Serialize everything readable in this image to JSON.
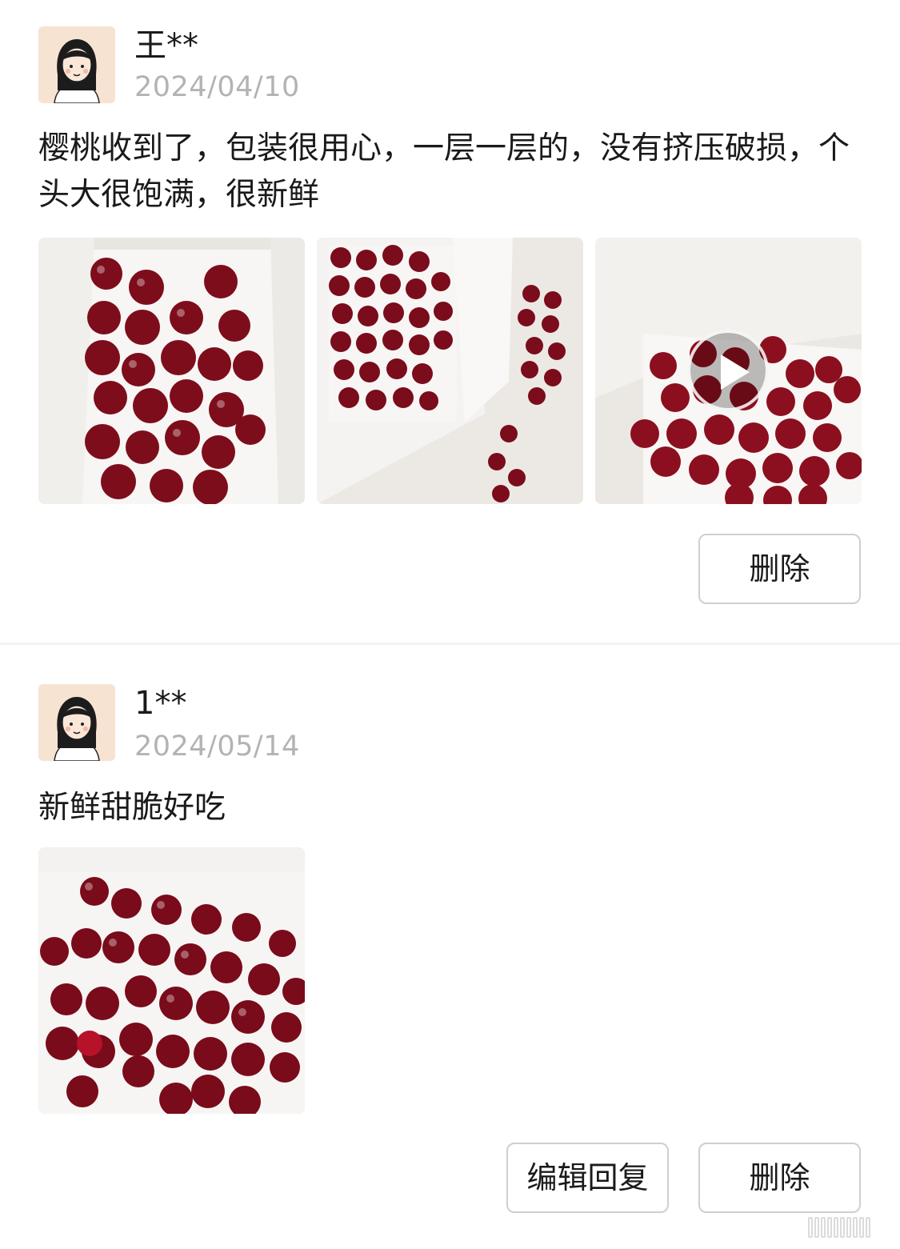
{
  "reviews": [
    {
      "username": "王**",
      "date": "2024/04/10",
      "content": "樱桃收到了，包装很用心，一层一层的，没有挤压破损，个头大很饱满，很新鲜",
      "media": [
        "cherries-photo",
        "cherries-photo",
        "cherries-video"
      ],
      "buttons": {
        "delete": "删除"
      }
    },
    {
      "username": "1**",
      "date": "2024/05/14",
      "content": "新鲜甜脆好吃",
      "media": [
        "cherries-photo"
      ],
      "buttons": {
        "edit_reply": "编辑回复",
        "delete": "删除"
      }
    }
  ],
  "icons": {
    "play": "play-icon",
    "avatar": "avatar-girl-icon"
  },
  "colors": {
    "date_text": "#b3b3b3",
    "button_border": "#cfcfcf",
    "avatar_bg": "#f7e3d2",
    "cherry": "#8a0f1e"
  }
}
